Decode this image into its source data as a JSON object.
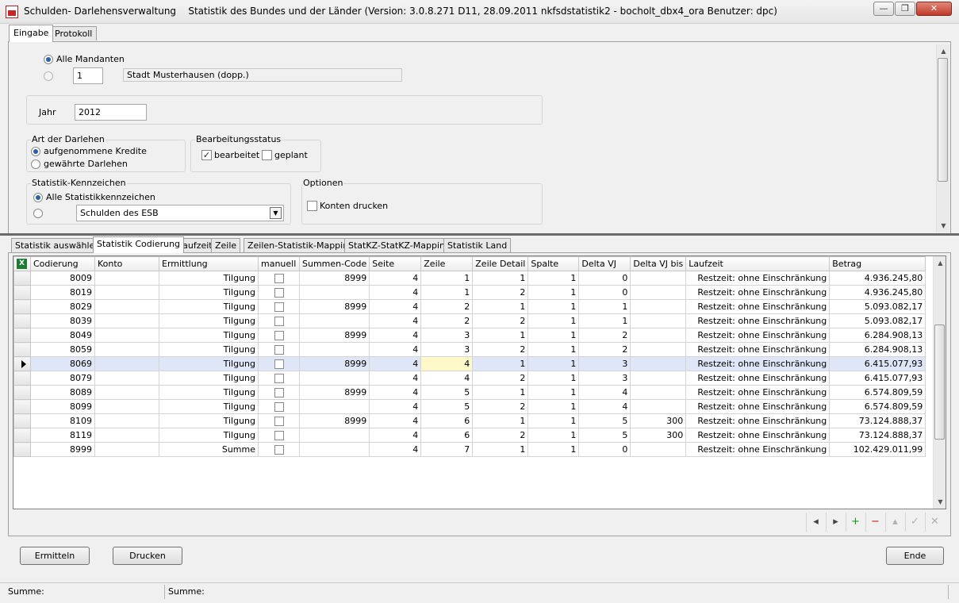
{
  "window": {
    "icon": "app-icon",
    "title": "Schulden- Darlehensverwaltung",
    "subtitle": "Statistik des Bundes und der Länder (Version: 3.0.8.271 D11, 28.09.2011 nkfsdstatistik2 - bocholt_dbx4_ora  Benutzer: dpc)",
    "minimize_symbol": "—",
    "restore_symbol": "❐",
    "close_symbol": "✕"
  },
  "main_tabs": [
    {
      "label": "Eingabe",
      "active": true
    },
    {
      "label": "Protokoll",
      "active": false
    }
  ],
  "mandant": {
    "all_label": "Alle Mandanten",
    "all_selected": true,
    "number_value": "1",
    "name_value": "Stadt Musterhausen (dopp.)"
  },
  "year": {
    "label": "Jahr",
    "value": "2012"
  },
  "loan_type": {
    "title": "Art der Darlehen",
    "options": [
      {
        "label": "aufgenommene Kredite",
        "selected": true
      },
      {
        "label": "gewährte Darlehen",
        "selected": false
      }
    ]
  },
  "status": {
    "title": "Bearbeitungsstatus",
    "bearbeitet_label": "bearbeitet",
    "bearbeitet_checked": true,
    "geplant_label": "geplant",
    "geplant_checked": false,
    "check_mark": "✓"
  },
  "kennzeichen": {
    "title": "Statistik-Kennzeichen",
    "all_label": "Alle Statistikkennzeichen",
    "all_selected": true,
    "select_value": "Schulden des ESB",
    "select_arrow": "▼"
  },
  "options": {
    "title": "Optionen",
    "konten_label": "Konten drucken",
    "konten_checked": false
  },
  "sub_tabs": [
    {
      "label": "Statistik auswählen",
      "active": false
    },
    {
      "label": "Statistik Codierung",
      "active": true
    },
    {
      "label": "Laufzeit",
      "active": false
    },
    {
      "label": "Zeile",
      "active": false
    },
    {
      "label": "Zeilen-Statistik-Mapping",
      "active": false
    },
    {
      "label": "StatKZ-StatKZ-Mapping",
      "active": false
    },
    {
      "label": "Statistik Land",
      "active": false
    }
  ],
  "grid": {
    "export_icon": "excel-icon",
    "export_glyph": "X",
    "columns": [
      "Codierung",
      "Konto",
      "Ermittlung",
      "manuell",
      "Summen-Code",
      "Seite",
      "Zeile",
      "Zeile Detail",
      "Spalte",
      "Delta VJ",
      "Delta VJ bis",
      "Laufzeit",
      "Betrag"
    ],
    "selected_row_index": 6,
    "rows": [
      [
        "8009",
        "",
        "Tilgung",
        "",
        "8999",
        "4",
        "1",
        "1",
        "1",
        "0",
        "",
        "Restzeit: ohne Einschränkung",
        "4.936.245,80"
      ],
      [
        "8019",
        "",
        "Tilgung",
        "",
        "",
        "4",
        "1",
        "2",
        "1",
        "0",
        "",
        "Restzeit: ohne Einschränkung",
        "4.936.245,80"
      ],
      [
        "8029",
        "",
        "Tilgung",
        "",
        "8999",
        "4",
        "2",
        "1",
        "1",
        "1",
        "",
        "Restzeit: ohne Einschränkung",
        "5.093.082,17"
      ],
      [
        "8039",
        "",
        "Tilgung",
        "",
        "",
        "4",
        "2",
        "2",
        "1",
        "1",
        "",
        "Restzeit: ohne Einschränkung",
        "5.093.082,17"
      ],
      [
        "8049",
        "",
        "Tilgung",
        "",
        "8999",
        "4",
        "3",
        "1",
        "1",
        "2",
        "",
        "Restzeit: ohne Einschränkung",
        "6.284.908,13"
      ],
      [
        "8059",
        "",
        "Tilgung",
        "",
        "",
        "4",
        "3",
        "2",
        "1",
        "2",
        "",
        "Restzeit: ohne Einschränkung",
        "6.284.908,13"
      ],
      [
        "8069",
        "",
        "Tilgung",
        "",
        "8999",
        "4",
        "4",
        "1",
        "1",
        "3",
        "",
        "Restzeit: ohne Einschränkung",
        "6.415.077,93"
      ],
      [
        "8079",
        "",
        "Tilgung",
        "",
        "",
        "4",
        "4",
        "2",
        "1",
        "3",
        "",
        "Restzeit: ohne Einschränkung",
        "6.415.077,93"
      ],
      [
        "8089",
        "",
        "Tilgung",
        "",
        "8999",
        "4",
        "5",
        "1",
        "1",
        "4",
        "",
        "Restzeit: ohne Einschränkung",
        "6.574.809,59"
      ],
      [
        "8099",
        "",
        "Tilgung",
        "",
        "",
        "4",
        "5",
        "2",
        "1",
        "4",
        "",
        "Restzeit: ohne Einschränkung",
        "6.574.809,59"
      ],
      [
        "8109",
        "",
        "Tilgung",
        "",
        "8999",
        "4",
        "6",
        "1",
        "1",
        "5",
        "300",
        "Restzeit: ohne Einschränkung",
        "73.124.888,37"
      ],
      [
        "8119",
        "",
        "Tilgung",
        "",
        "",
        "4",
        "6",
        "2",
        "1",
        "5",
        "300",
        "Restzeit: ohne Einschränkung",
        "73.124.888,37"
      ],
      [
        "8999",
        "",
        "Summe",
        "",
        "",
        "4",
        "7",
        "1",
        "1",
        "0",
        "",
        "Restzeit: ohne Einschränkung",
        "102.429.011,99"
      ]
    ]
  },
  "navigator": [
    {
      "name": "nav-prior-button",
      "glyph": "◂",
      "color": "#444444"
    },
    {
      "name": "nav-next-button",
      "glyph": "▸",
      "color": "#444444"
    },
    {
      "name": "nav-insert-button",
      "glyph": "+",
      "color": "#1a9a1a"
    },
    {
      "name": "nav-delete-button",
      "glyph": "−",
      "color": "#d01818"
    },
    {
      "name": "nav-edit-button",
      "glyph": "▴",
      "color": "#b0b0b0"
    },
    {
      "name": "nav-post-button",
      "glyph": "✓",
      "color": "#b0b0b0"
    },
    {
      "name": "nav-cancel-button",
      "glyph": "✕",
      "color": "#b0b0b0"
    }
  ],
  "buttons": {
    "ermitteln": "Ermitteln",
    "drucken": "Drucken",
    "ende": "Ende"
  },
  "statusbar": {
    "left": "Summe:",
    "right": "Summe:"
  }
}
